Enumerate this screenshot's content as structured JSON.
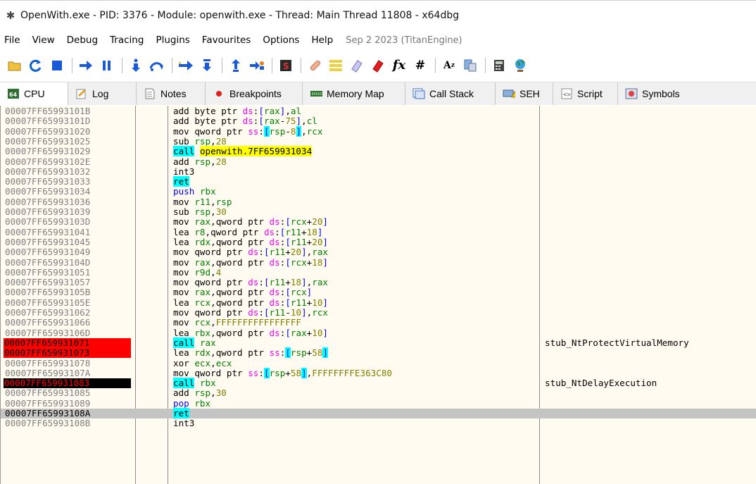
{
  "window": {
    "title": "OpenWith.exe - PID: 3376 - Module: openwith.exe - Thread: Main Thread 11808 - x64dbg"
  },
  "menu": {
    "items": [
      "File",
      "View",
      "Debug",
      "Tracing",
      "Plugins",
      "Favourites",
      "Options",
      "Help"
    ],
    "version": "Sep 2 2023 (TitanEngine)"
  },
  "toolbar": {
    "icons": [
      "open-icon",
      "restart-icon",
      "stop-icon",
      "run-icon",
      "pause-icon",
      "step-into-icon",
      "step-over-icon",
      "trace-into-icon",
      "trace-over-icon",
      "execute-till-return-icon",
      "run-to-user-code-icon",
      "scylla-icon",
      "patch-icon",
      "comments-icon",
      "labels-icon",
      "bookmarks-icon",
      "functions-icon",
      "variables-icon",
      "strings-icon",
      "calls-icon",
      "calculator-icon",
      "globe-icon"
    ]
  },
  "tabs": [
    {
      "label": "CPU",
      "icon": "cpu-icon"
    },
    {
      "label": "Log",
      "icon": "log-icon"
    },
    {
      "label": "Notes",
      "icon": "notes-icon"
    },
    {
      "label": "Breakpoints",
      "icon": "breakpoint-dot-icon"
    },
    {
      "label": "Memory Map",
      "icon": "memory-map-icon"
    },
    {
      "label": "Call Stack",
      "icon": "call-stack-icon"
    },
    {
      "label": "SEH",
      "icon": "seh-icon"
    },
    {
      "label": "Script",
      "icon": "script-icon"
    },
    {
      "label": "Symbols",
      "icon": "symbols-icon"
    }
  ],
  "colors": {
    "breakpoint": "#ff0000",
    "current_ip": "#000000",
    "call_highlight": "#00ffff",
    "call_target": "#ffff00",
    "selection": "#c4c4c4",
    "background": "#fffbf0"
  },
  "disasm": {
    "rows": [
      {
        "addr": "00007FF65993101B",
        "mn": "add",
        "ops": "byte ptr ds:[rax],al",
        "cmt": ""
      },
      {
        "addr": "00007FF65993101D",
        "mn": "add",
        "ops": "byte ptr ds:[rax-75],cl",
        "cmt": ""
      },
      {
        "addr": "00007FF659931020",
        "mn": "mov",
        "ops": "qword ptr ss:[rsp-8],rcx",
        "cmt": ""
      },
      {
        "addr": "00007FF659931025",
        "mn": "sub",
        "ops": "rsp,28",
        "cmt": ""
      },
      {
        "addr": "00007FF659931029",
        "mn": "call",
        "ops": "openwith.7FF659931034",
        "cmt": ""
      },
      {
        "addr": "00007FF65993102E",
        "mn": "add",
        "ops": "rsp,28",
        "cmt": ""
      },
      {
        "addr": "00007FF659931032",
        "mn": "int3",
        "ops": "",
        "cmt": ""
      },
      {
        "addr": "00007FF659931033",
        "mn": "ret",
        "ops": "",
        "cmt": ""
      },
      {
        "addr": "00007FF659931034",
        "mn": "push",
        "ops": "rbx",
        "cmt": ""
      },
      {
        "addr": "00007FF659931036",
        "mn": "mov",
        "ops": "r11,rsp",
        "cmt": ""
      },
      {
        "addr": "00007FF659931039",
        "mn": "sub",
        "ops": "rsp,30",
        "cmt": ""
      },
      {
        "addr": "00007FF65993103D",
        "mn": "mov",
        "ops": "rax,qword ptr ds:[rcx+20]",
        "cmt": ""
      },
      {
        "addr": "00007FF659931041",
        "mn": "lea",
        "ops": "r8,qword ptr ds:[r11+18]",
        "cmt": ""
      },
      {
        "addr": "00007FF659931045",
        "mn": "lea",
        "ops": "rdx,qword ptr ds:[r11+20]",
        "cmt": ""
      },
      {
        "addr": "00007FF659931049",
        "mn": "mov",
        "ops": "qword ptr ds:[r11+20],rax",
        "cmt": ""
      },
      {
        "addr": "00007FF65993104D",
        "mn": "mov",
        "ops": "rax,qword ptr ds:[rcx+18]",
        "cmt": ""
      },
      {
        "addr": "00007FF659931051",
        "mn": "mov",
        "ops": "r9d,4",
        "cmt": ""
      },
      {
        "addr": "00007FF659931057",
        "mn": "mov",
        "ops": "qword ptr ds:[r11+18],rax",
        "cmt": ""
      },
      {
        "addr": "00007FF65993105B",
        "mn": "mov",
        "ops": "rax,qword ptr ds:[rcx]",
        "cmt": ""
      },
      {
        "addr": "00007FF65993105E",
        "mn": "lea",
        "ops": "rcx,qword ptr ds:[r11+10]",
        "cmt": ""
      },
      {
        "addr": "00007FF659931062",
        "mn": "mov",
        "ops": "qword ptr ds:[r11-10],rcx",
        "cmt": ""
      },
      {
        "addr": "00007FF659931066",
        "mn": "mov",
        "ops": "rcx,FFFFFFFFFFFFFFFF",
        "cmt": ""
      },
      {
        "addr": "00007FF65993106D",
        "mn": "lea",
        "ops": "rbx,qword ptr ds:[rax+10]",
        "cmt": ""
      },
      {
        "addr": "00007FF659931071",
        "mn": "call",
        "ops": "rax",
        "cmt": "stub_NtProtectVirtualMemory"
      },
      {
        "addr": "00007FF659931073",
        "mn": "lea",
        "ops": "rdx,qword ptr ss:[rsp+58]",
        "cmt": ""
      },
      {
        "addr": "00007FF659931078",
        "mn": "xor",
        "ops": "ecx,ecx",
        "cmt": ""
      },
      {
        "addr": "00007FF65993107A",
        "mn": "mov",
        "ops": "qword ptr ss:[rsp+58],FFFFFFFFE363C80",
        "cmt": ""
      },
      {
        "addr": "00007FF659931083",
        "mn": "call",
        "ops": "rbx",
        "cmt": "stub_NtDelayExecution"
      },
      {
        "addr": "00007FF659931085",
        "mn": "add",
        "ops": "rsp,30",
        "cmt": ""
      },
      {
        "addr": "00007FF659931089",
        "mn": "pop",
        "ops": "rbx",
        "cmt": ""
      },
      {
        "addr": "00007FF65993108A",
        "mn": "ret",
        "ops": "",
        "cmt": ""
      },
      {
        "addr": "00007FF65993108B",
        "mn": "int3",
        "ops": "",
        "cmt": ""
      }
    ]
  }
}
